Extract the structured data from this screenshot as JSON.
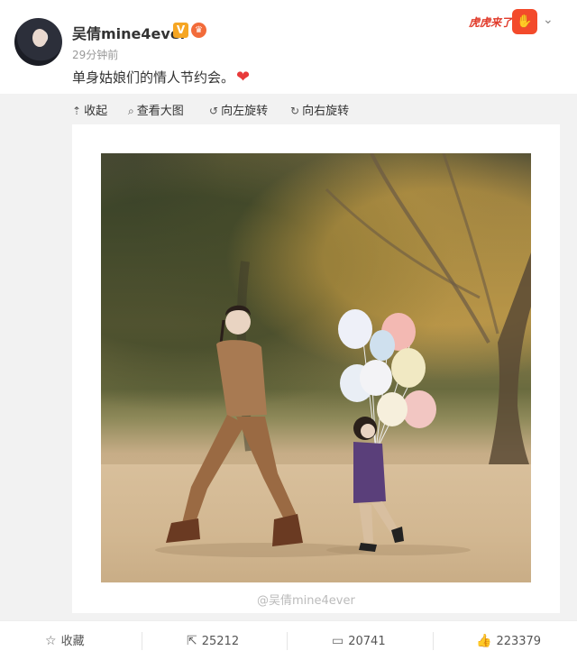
{
  "post": {
    "username": "吴倩mine4ever",
    "verified_badge": "V",
    "timestamp": "29分钟前",
    "text": "单身姑娘们的情人节约会。",
    "heart_glyph": "❤",
    "promo_badge": "虎虎来了"
  },
  "toolbar": {
    "collapse_label": "收起",
    "view_large_label": "查看大图",
    "rotate_left_label": "向左旋转",
    "rotate_right_label": "向右旋转"
  },
  "photo": {
    "watermark": "@吴倩mine4ever"
  },
  "actions": {
    "favorite_label": "收藏",
    "repost_count": "25212",
    "comment_count": "20741",
    "like_count": "223379"
  },
  "colors": {
    "accent_orange": "#f6a623",
    "heart_red": "#e83a3a",
    "media_bg": "#f2f2f2"
  }
}
